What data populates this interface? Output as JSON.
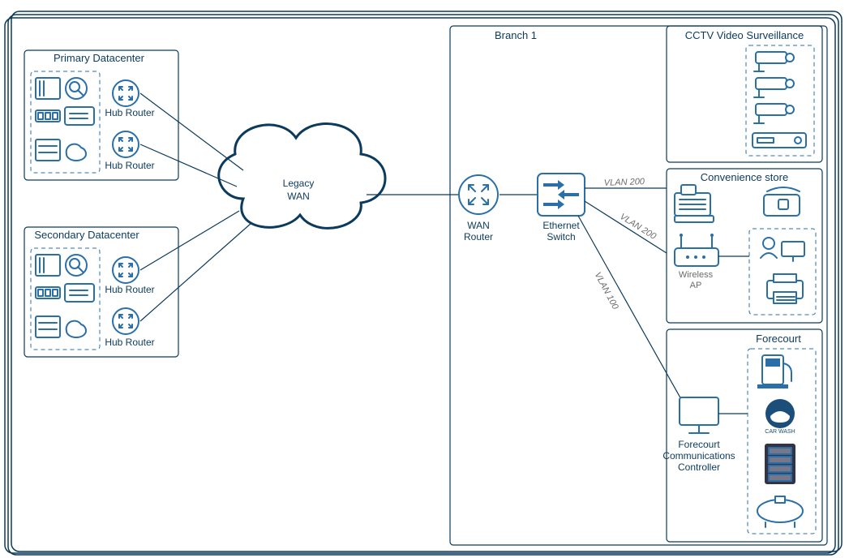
{
  "datacenters": {
    "primary": {
      "title": "Primary Datacenter",
      "hubRouters": [
        "Hub Router",
        "Hub Router"
      ]
    },
    "secondary": {
      "title": "Secondary Datacenter",
      "hubRouters": [
        "Hub Router",
        "Hub Router"
      ]
    }
  },
  "wan": {
    "cloudLabel1": "Legacy",
    "cloudLabel2": "WAN",
    "wanRouter": "WAN",
    "wanRouter2": "Router",
    "ethSwitch1": "Ethernet",
    "ethSwitch2": "Switch"
  },
  "branch": {
    "title": "Branch 1",
    "vlan200a": "VLAN 200",
    "vlan200b": "VLAN 200",
    "vlan100": "VLAN 100"
  },
  "cctv": {
    "title": "CCTV Video Surveillance"
  },
  "store": {
    "title": "Convenience store",
    "wirelessAP1": "Wireless",
    "wirelessAP2": "AP"
  },
  "forecourt": {
    "title": "Forecourt",
    "fcc1": "Forecourt",
    "fcc2": "Communications",
    "fcc3": "Controller",
    "carwash": "CAR WASH"
  }
}
